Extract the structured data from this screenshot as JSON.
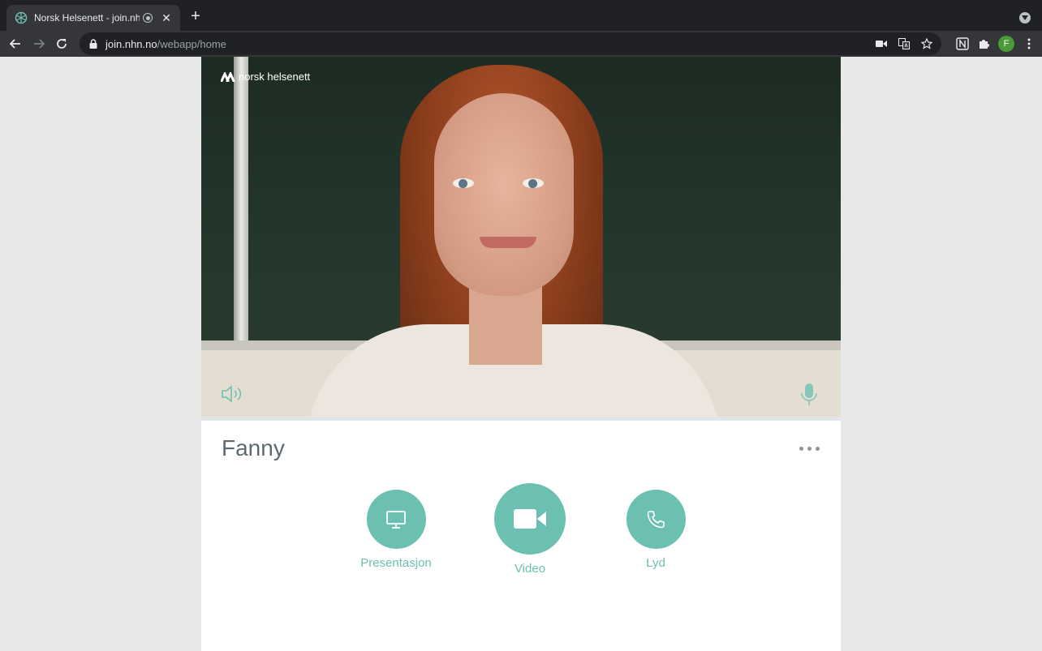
{
  "browser": {
    "tab_title": "Norsk Helsenett - join.nhn.",
    "url_host": "join.nhn.no",
    "url_path": "/webapp/home",
    "profile_initial": "F"
  },
  "video": {
    "logo_text": "norsk helsenett"
  },
  "participant": {
    "name": "Fanny"
  },
  "controls": {
    "presentation_label": "Presentasjon",
    "video_label": "Video",
    "audio_label": "Lyd"
  },
  "colors": {
    "accent": "#6cc0b2",
    "name_text": "#5e6a72",
    "chrome_dark": "#202124",
    "chrome_toolbar": "#35363a",
    "page_bg": "#e8e8e8"
  },
  "icons": {
    "tab_favicon": "nhn-favicon-icon",
    "presentation": "monitor-icon",
    "video": "video-camera-icon",
    "audio": "phone-icon",
    "speaker": "speaker-icon",
    "mic": "microphone-icon",
    "more": "more-dots-icon"
  }
}
